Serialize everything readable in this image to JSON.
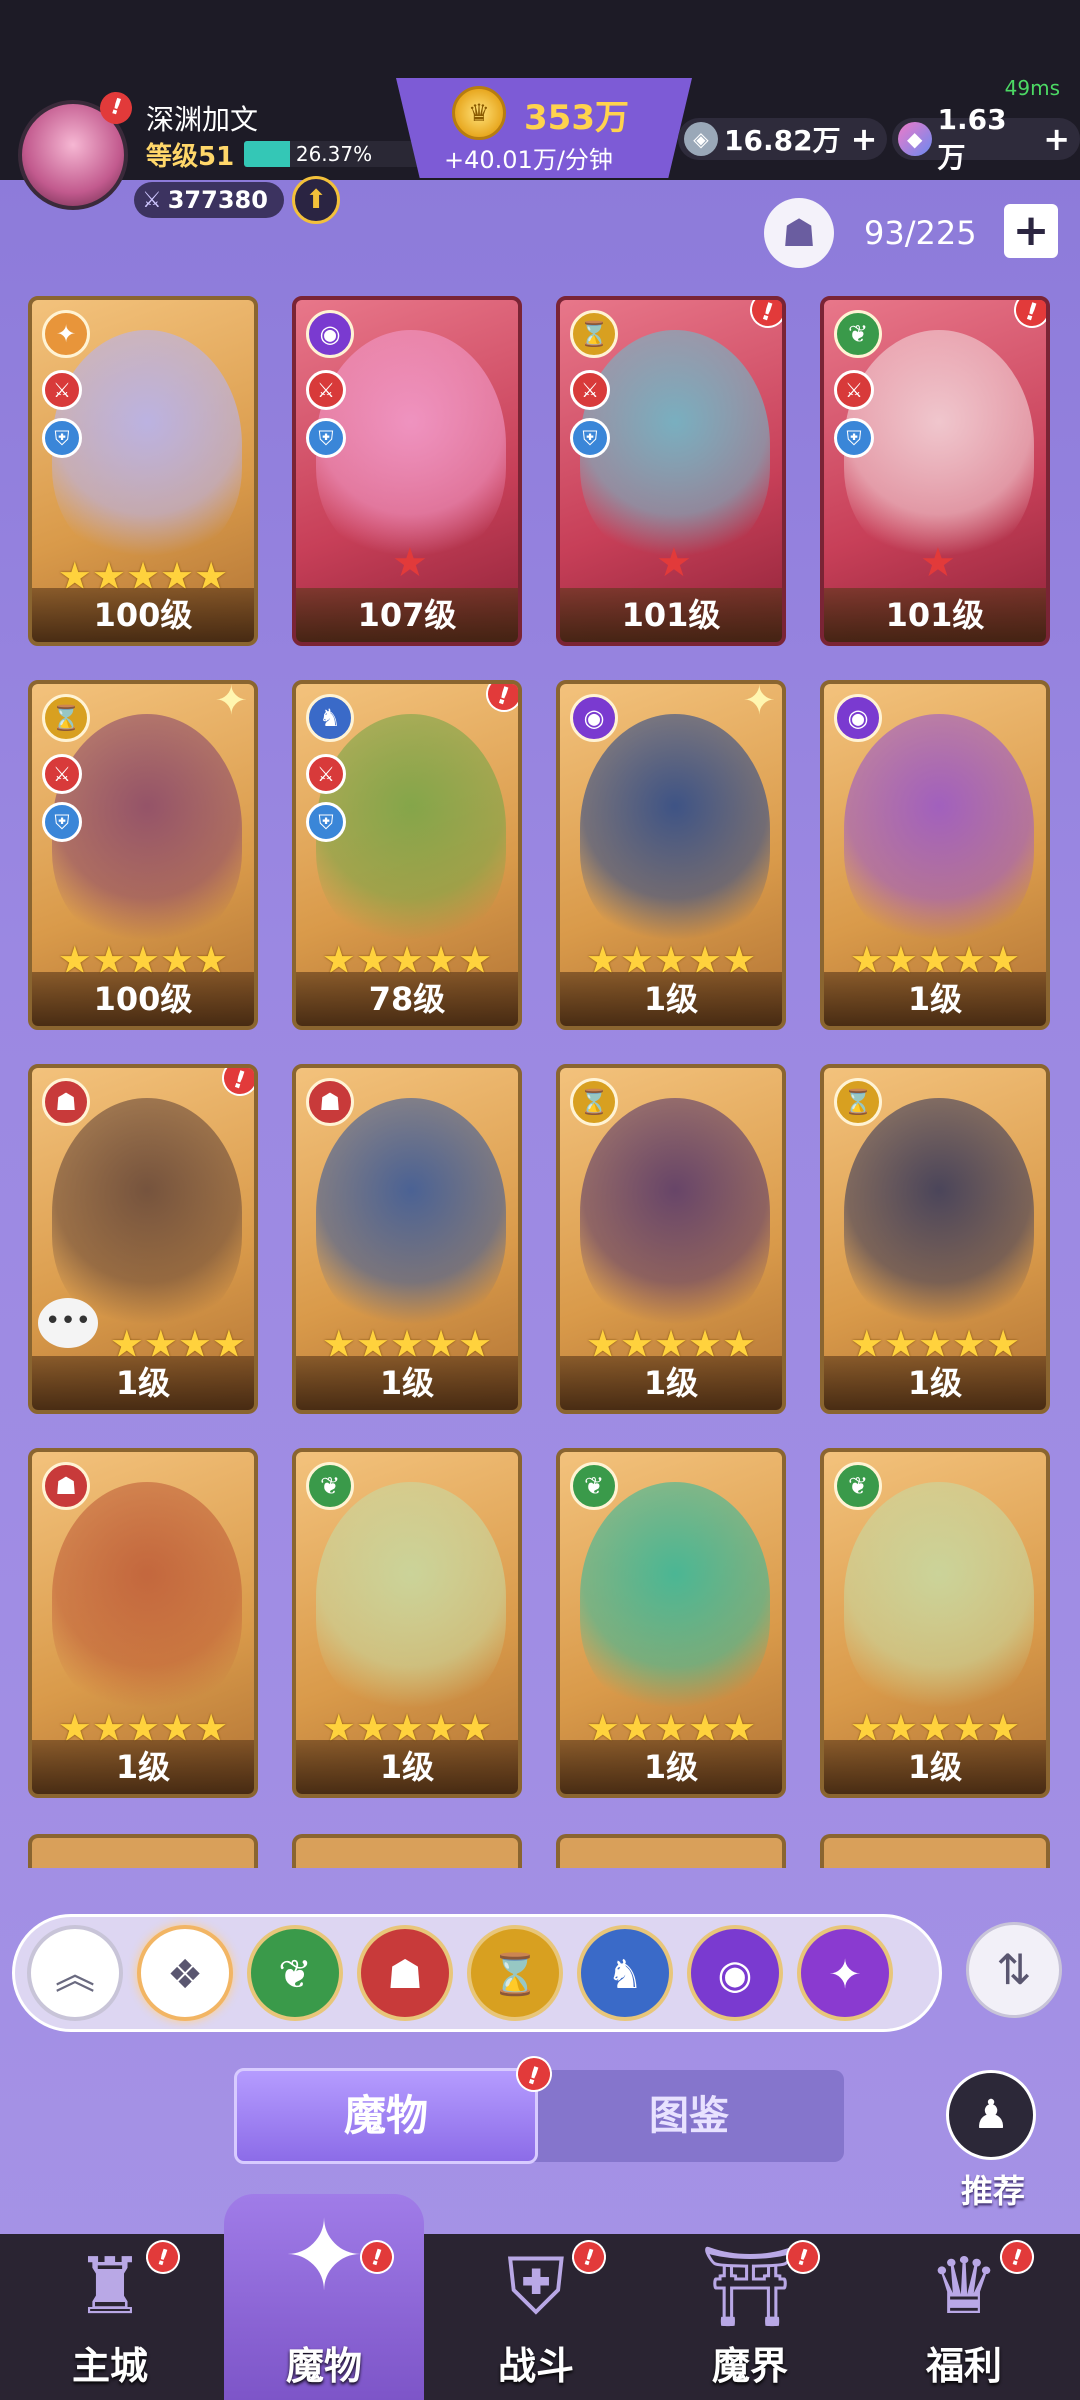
{
  "status": {
    "ping": "49ms"
  },
  "player": {
    "name": "深渊加文",
    "level": "等级51",
    "xp_percent": "26.37%",
    "xp_fraction": 0.2637,
    "power": "377380"
  },
  "currency": {
    "gold": "353万",
    "gold_rate": "+40.01万/分钟",
    "crystal": "16.82万",
    "gem": "1.63万"
  },
  "roster": {
    "capacity": "93/225"
  },
  "cards": [
    {
      "level": "100级",
      "stars": 5,
      "red_star": false,
      "bg": "gold",
      "faction": "orange",
      "faction_glyph": "✦",
      "role_badges": true,
      "alert": false,
      "sparkle": false,
      "art": "#b7b3f0"
    },
    {
      "level": "107级",
      "stars": 0,
      "red_star": true,
      "bg": "red",
      "faction": "purple",
      "faction_glyph": "◉",
      "role_badges": true,
      "alert": false,
      "sparkle": false,
      "art": "#f29ac9"
    },
    {
      "level": "101级",
      "stars": 0,
      "red_star": true,
      "bg": "red",
      "faction": "gold",
      "faction_glyph": "⌛",
      "role_badges": true,
      "alert": true,
      "sparkle": false,
      "art": "#6fb9c9"
    },
    {
      "level": "101级",
      "stars": 0,
      "red_star": true,
      "bg": "red",
      "faction": "green",
      "faction_glyph": "❦",
      "role_badges": true,
      "alert": true,
      "sparkle": false,
      "art": "#f3d3d8"
    },
    {
      "level": "100级",
      "stars": 5,
      "red_star": false,
      "bg": "gold",
      "faction": "gold",
      "faction_glyph": "⌛",
      "role_badges": true,
      "alert": false,
      "sparkle": true,
      "art": "#8c4a6a"
    },
    {
      "level": "78级",
      "stars": 5,
      "red_star": false,
      "bg": "gold",
      "faction": "blue",
      "faction_glyph": "♞",
      "role_badges": true,
      "alert": true,
      "sparkle": false,
      "art": "#7aa548"
    },
    {
      "level": "1级",
      "stars": 5,
      "red_star": false,
      "bg": "gold",
      "faction": "purple",
      "faction_glyph": "◉",
      "role_badges": false,
      "alert": false,
      "sparkle": true,
      "art": "#2c4a8a"
    },
    {
      "level": "1级",
      "stars": 5,
      "red_star": false,
      "bg": "gold",
      "faction": "purple",
      "faction_glyph": "◉",
      "role_badges": false,
      "alert": false,
      "sparkle": false,
      "art": "#9a58c8"
    },
    {
      "level": "1级",
      "stars": 4,
      "red_star": false,
      "bg": "gold",
      "faction": "red",
      "faction_glyph": "☗",
      "role_badges": false,
      "alert": true,
      "sparkle": false,
      "art": "#6a4a3a",
      "chat": true
    },
    {
      "level": "1级",
      "stars": 5,
      "red_star": false,
      "bg": "gold",
      "faction": "red",
      "faction_glyph": "☗",
      "role_badges": false,
      "alert": false,
      "sparkle": false,
      "art": "#3a5a9a"
    },
    {
      "level": "1级",
      "stars": 5,
      "red_star": false,
      "bg": "gold",
      "faction": "gold",
      "faction_glyph": "⌛",
      "role_badges": false,
      "alert": false,
      "sparkle": false,
      "art": "#5a3a6a"
    },
    {
      "level": "1级",
      "stars": 5,
      "red_star": false,
      "bg": "gold",
      "faction": "gold",
      "faction_glyph": "⌛",
      "role_badges": false,
      "alert": false,
      "sparkle": false,
      "art": "#3a3a5a"
    },
    {
      "level": "1级",
      "stars": 5,
      "red_star": false,
      "bg": "gold",
      "faction": "red",
      "faction_glyph": "☗",
      "role_badges": false,
      "alert": false,
      "sparkle": false,
      "art": "#c0603a"
    },
    {
      "level": "1级",
      "stars": 5,
      "red_star": false,
      "bg": "gold",
      "faction": "green",
      "faction_glyph": "❦",
      "role_badges": false,
      "alert": false,
      "sparkle": false,
      "art": "#c8d8a0"
    },
    {
      "level": "1级",
      "stars": 5,
      "red_star": false,
      "bg": "gold",
      "faction": "green",
      "faction_glyph": "❦",
      "role_badges": false,
      "alert": false,
      "sparkle": false,
      "art": "#3ab89a"
    },
    {
      "level": "1级",
      "stars": 5,
      "red_star": false,
      "bg": "gold",
      "faction": "green",
      "faction_glyph": "❦",
      "role_badges": false,
      "alert": false,
      "sparkle": false,
      "art": "#c8d8a0"
    }
  ],
  "faction_colors": {
    "orange": "#e8953a",
    "purple": "#7a3ad0",
    "gold": "#d8a020",
    "green": "#3a9a4a",
    "blue": "#3a6ac8",
    "red": "#c83a3a"
  },
  "filters": [
    {
      "name": "collapse-filter-button",
      "glyph": "︽",
      "kind": "collapse"
    },
    {
      "name": "filter-all-button",
      "glyph": "❖",
      "kind": "all"
    },
    {
      "name": "filter-nature-button",
      "glyph": "❦",
      "color": "#3a9a4a"
    },
    {
      "name": "filter-demon-button",
      "glyph": "☗",
      "color": "#c83a3a"
    },
    {
      "name": "filter-time-button",
      "glyph": "⌛",
      "color": "#d8a020"
    },
    {
      "name": "filter-dragon-button",
      "glyph": "♞",
      "color": "#3a6ac8"
    },
    {
      "name": "filter-eye-button",
      "glyph": "◉",
      "color": "#7a3ad0"
    },
    {
      "name": "filter-chaos-button",
      "glyph": "✦",
      "color": "#8a3ad0"
    }
  ],
  "tabs": {
    "monsters": "魔物",
    "codex": "图鉴"
  },
  "recommend_label": "推荐",
  "nav": [
    {
      "label": "主城",
      "icon": "castle-icon",
      "glyph": "♜",
      "active": false
    },
    {
      "label": "魔物",
      "icon": "flame-icon",
      "glyph": "✦",
      "active": true
    },
    {
      "label": "战斗",
      "icon": "shield-icon",
      "glyph": "⛨",
      "active": false
    },
    {
      "label": "魔界",
      "icon": "portal-icon",
      "glyph": "⛩",
      "active": false
    },
    {
      "label": "福利",
      "icon": "chest-icon",
      "glyph": "♛",
      "active": false
    }
  ]
}
